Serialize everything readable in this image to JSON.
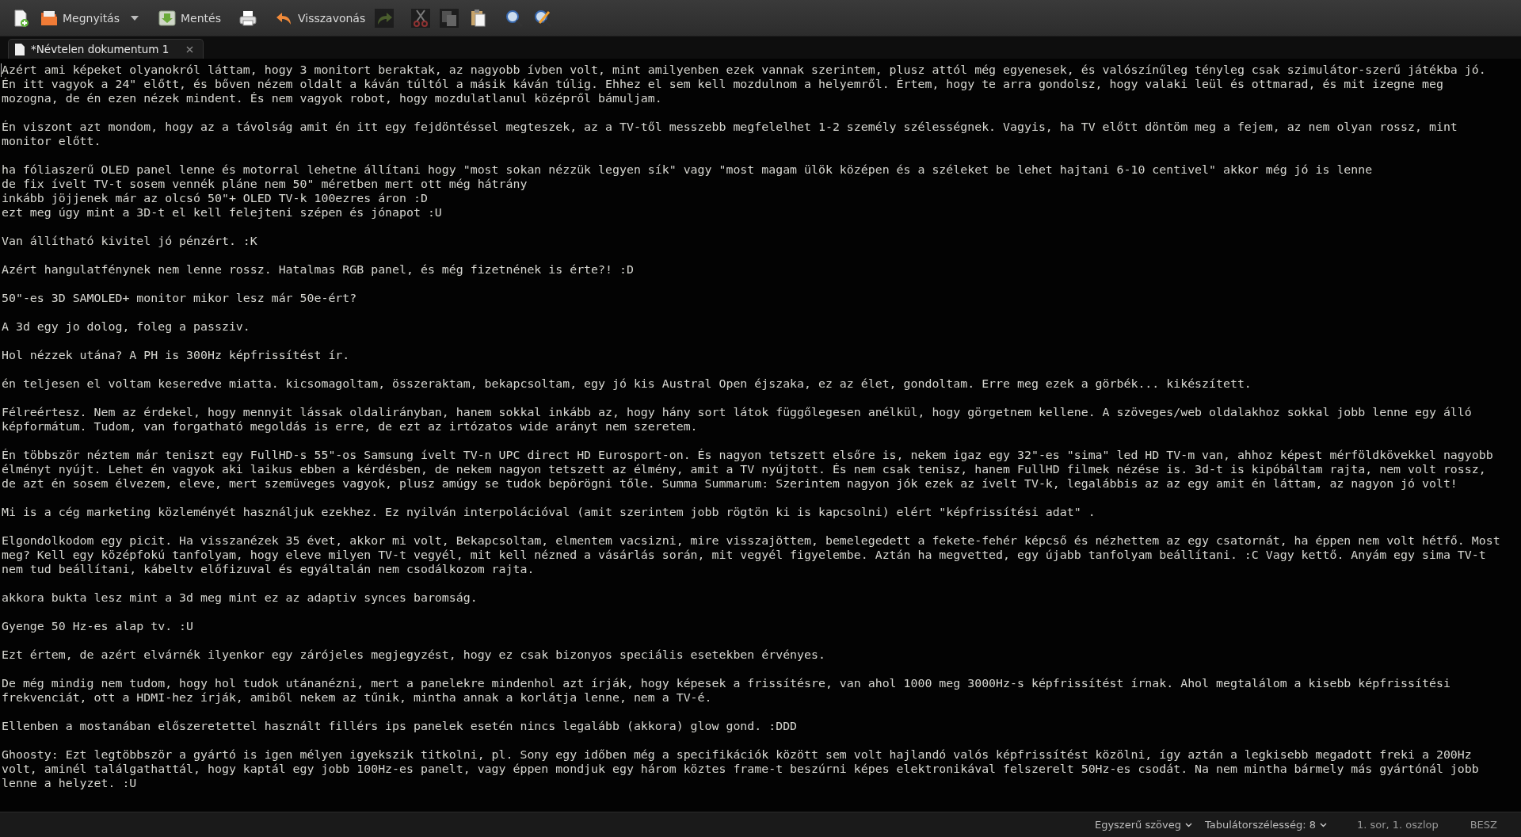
{
  "toolbar": [
    {
      "kind": "button",
      "disabled": false
    },
    {
      "kind": "button",
      "label": "Megnyitás",
      "disabled": false
    },
    {
      "kind": "menu-arrow",
      "disabled": false
    },
    {
      "kind": "button",
      "label": "Mentés",
      "disabled": false
    },
    {
      "kind": "button",
      "disabled": false
    },
    {
      "kind": "button",
      "label": "Visszavonás",
      "disabled": false
    },
    {
      "kind": "button",
      "disabled": true
    },
    {
      "kind": "button",
      "disabled": true
    },
    {
      "kind": "button",
      "disabled": true
    },
    {
      "kind": "button",
      "disabled": false
    },
    {
      "kind": "button",
      "disabled": false
    },
    {
      "kind": "button",
      "disabled": false
    }
  ],
  "tabs": [
    {
      "title": "*Névtelen dokumentum 1",
      "selected": true
    }
  ],
  "editor": {
    "paragraphs": [
      {
        "lines": [
          "Azért ami képeket olyanokról láttam, hogy 3 monitort beraktak, az nagyobb ívben volt, mint amilyenben ezek vannak szerintem, plusz attól még egyenesek, és valószínűleg tényleg csak szimulátor-szerű játékba jó.",
          "Én itt vagyok a 24\" előtt, és bőven nézem oldalt a káván túltól a másik káván túlig. Ehhez el sem kell mozdulnom a helyemről. Értem, hogy te arra gondolsz, hogy valaki leül és ottmarad, és mit izegne meg",
          "mozogna, de én ezen nézek mindent. És nem vagyok robot, hogy mozdulatlanul középről bámuljam."
        ]
      },
      {
        "lines": [
          "Én viszont azt mondom, hogy az a távolság amit én itt egy fejdöntéssel megteszek, az a TV-től messzebb megfelelhet 1-2 személy szélességnek. Vagyis, ha TV előtt döntöm meg a fejem, az nem olyan rossz, mint",
          "monitor előtt."
        ]
      },
      {
        "lines": [
          "ha fóliaszerű OLED panel lenne és motorral lehetne állítani hogy \"most sokan nézzük legyen sík\" vagy \"most magam ülök középen és a széleket be lehet hajtani 6-10 centivel\" akkor még jó is lenne",
          "de fix ívelt TV-t sosem vennék pláne nem 50\" méretben mert ott még hátrány",
          "inkább jöjjenek már az olcsó 50\"+ OLED TV-k 100ezres áron :D",
          "ezt meg úgy mint a 3D-t el kell felejteni szépen és jónapot :U"
        ]
      },
      {
        "lines": [
          "Van állítható kivitel jó pénzért. :K"
        ]
      },
      {
        "lines": [
          "Azért hangulatfénynek nem lenne rossz. Hatalmas RGB panel, és még fizetnének is érte?! :D"
        ]
      },
      {
        "lines": [
          "50\"-es 3D SAMOLED+ monitor mikor lesz már 50e-ért?"
        ]
      },
      {
        "lines": [
          "A 3d egy jo dolog, foleg a passziv."
        ]
      },
      {
        "lines": [
          "Hol nézzek utána? A PH is 300Hz képfrissítést ír."
        ]
      },
      {
        "lines": [
          "én teljesen el voltam keseredve miatta. kicsomagoltam, összeraktam, bekapcsoltam, egy jó kis Austral Open éjszaka, ez az élet, gondoltam. Erre meg ezek a görbék... kikészített."
        ]
      },
      {
        "lines": [
          "Félreértesz. Nem az érdekel, hogy mennyit lássak oldalirányban, hanem sokkal inkább az, hogy hány sort látok függőlegesen anélkül, hogy görgetnem kellene. A szöveges/web oldalakhoz sokkal jobb lenne egy álló",
          "képformátum. Tudom, van forgatható megoldás is erre, de ezt az irtózatos wide arányt nem szeretem."
        ]
      },
      {
        "lines": [
          "Én többször néztem már teniszt egy FullHD-s 55\"-os Samsung ívelt TV-n UPC direct HD Eurosport-on. És nagyon tetszett elsőre is, nekem igaz egy 32\"-es \"sima\" led HD TV-m van, ahhoz képest mérföldkövekkel nagyobb",
          "élményt nyújt. Lehet én vagyok aki laikus ebben a kérdésben, de nekem nagyon tetszett az élmény, amit a TV nyújtott. És nem csak tenisz, hanem FullHD filmek nézése is. 3d-t is kipóbáltam rajta, nem volt rossz,",
          "de azt én sosem élvezem, eleve, mert szemüveges vagyok, plusz amúgy se tudok bepörögni tőle. Summa Summarum: Szerintem nagyon jók ezek az ívelt TV-k, legalábbis az az egy amit én láttam, az nagyon jó volt!"
        ]
      },
      {
        "lines": [
          "Mi is a cég marketing közleményét használjuk ezekhez. Ez nyilván interpolációval (amit szerintem jobb rögtön ki is kapcsolni) elért \"képfrissítési adat\" ."
        ]
      },
      {
        "lines": [
          "Elgondolkodom egy picit. Ha visszanézek 35 évet, akkor mi volt, Bekapcsoltam, elmentem vacsizni, mire visszajöttem, bemelegedett a fekete-fehér képcső és nézhettem az egy csatornát, ha éppen nem volt hétfő. Most",
          "meg? Kell egy középfokú tanfolyam, hogy eleve milyen TV-t vegyél, mit kell nézned a vásárlás során, mit vegyél figyelembe. Aztán ha megvetted, egy újabb tanfolyam beállítani. :C Vagy kettő. Anyám egy sima TV-t",
          "nem tud beállítani, kábeltv előfizuval és egyáltalán nem csodálkozom rajta."
        ]
      },
      {
        "lines": [
          "akkora bukta lesz mint a 3d meg mint ez az adaptiv synces baromság."
        ]
      },
      {
        "lines": [
          "Gyenge 50 Hz-es alap tv. :U"
        ]
      },
      {
        "lines": [
          "Ezt értem, de azért elvárnék ilyenkor egy zárójeles megjegyzést, hogy ez csak bizonyos speciális esetekben érvényes."
        ]
      },
      {
        "lines": [
          "De még mindig nem tudom, hogy hol tudok utánanézni, mert a panelekre mindenhol azt írják, hogy képesek a frissítésre, van ahol 1000 meg 3000Hz-s képfrissítést írnak. Ahol megtalálom a kisebb képfrissítési",
          "frekvenciát, ott a HDMI-hez írják, amiből nekem az tűnik, mintha annak a korlátja lenne, nem a TV-é."
        ]
      },
      {
        "lines": [
          "Ellenben a mostanában előszeretettel használt fillérs ips panelek esetén nincs legalább (akkora) glow gond. :DDD"
        ]
      },
      {
        "lines": [
          "Ghoosty: Ezt legtöbbször a gyártó is igen mélyen igyekszik titkolni, pl. Sony egy időben még a specifikációk között sem volt hajlandó valós képfrissítést közölni, így aztán a legkisebb megadott freki a 200Hz",
          "volt, aminél találgathattál, hogy kaptál egy jobb 100Hz-es panelt, vagy éppen mondjuk egy három köztes frame-t beszúrni képes elektronikával felszerelt 50Hz-es csodát. Na nem mintha bármely más gyártónál jobb",
          "lenne a helyzet. :U"
        ]
      }
    ]
  },
  "status_bar": {
    "language": "Egyszerű szöveg",
    "tab_width": "Tabulátorszélesség: 8",
    "position": "1. sor, 1. oszlop",
    "mode": "BESZ"
  }
}
